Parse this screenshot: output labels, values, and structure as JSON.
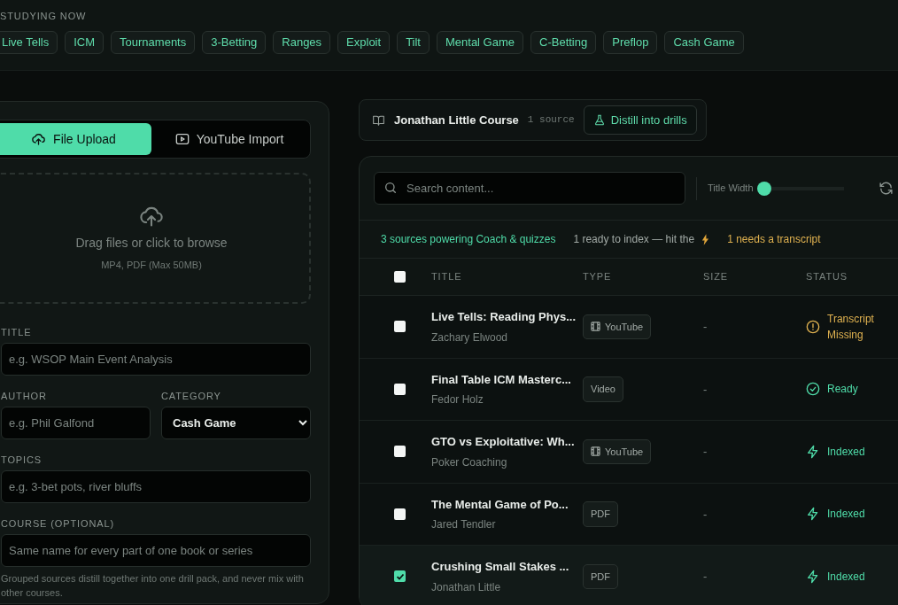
{
  "studying_now": {
    "label": "STUDYING NOW",
    "topics": [
      "Live Tells",
      "ICM",
      "Tournaments",
      "3-Betting",
      "Ranges",
      "Exploit",
      "Tilt",
      "Mental Game",
      "C-Betting",
      "Preflop",
      "Cash Game"
    ]
  },
  "upload": {
    "tabs": [
      {
        "label": "File Upload",
        "kind": "file",
        "selected": true
      },
      {
        "label": "YouTube Import",
        "kind": "youtube",
        "selected": false
      }
    ],
    "dropzone": {
      "title": "Drag files or click to browse",
      "hint": "MP4, PDF (Max 50MB)"
    },
    "fields": [
      {
        "label": "TITLE",
        "kind": "text",
        "placeholder": "e.g. WSOP Main Event Analysis"
      },
      {
        "label": "AUTHOR",
        "kind": "text",
        "placeholder": "e.g. Phil Galfond"
      },
      {
        "label": "CATEGORY",
        "kind": "select",
        "value": "Cash Game"
      },
      {
        "label": "TOPICS",
        "kind": "text",
        "placeholder": "e.g. 3-bet pots, river bluffs"
      },
      {
        "label": "COURSE (OPTIONAL)",
        "kind": "text",
        "placeholder": "Same name for every part of one book or series"
      }
    ],
    "help": "Grouped sources distill together into one drill pack, and never mix with other courses."
  },
  "course_bar": {
    "name": "Jonathan Little Course",
    "count": "1 source",
    "button": "Distill into drills"
  },
  "library": {
    "search": {
      "placeholder": "Search content..."
    },
    "title_width": {
      "label": "Title Width",
      "level": 0
    },
    "summary": {
      "sources": "3 sources powering Coach & quizzes",
      "ready": "1 ready to index — hit the",
      "transcript": "1 needs a transcript"
    },
    "columns": [
      "TITLE",
      "TYPE",
      "SIZE",
      "STATUS"
    ],
    "select_all": false,
    "rows": [
      {
        "title": "Live Tells: Reading Phys...",
        "author": "Zachary Elwood",
        "type": "YouTube",
        "type_icon": true,
        "size": "-",
        "status": "Transcript Missing",
        "kind": "missing",
        "selected": false
      },
      {
        "title": "Final Table ICM Masterc...",
        "author": "Fedor Holz",
        "type": "Video",
        "type_icon": false,
        "size": "-",
        "status": "Ready",
        "kind": "ready",
        "selected": false
      },
      {
        "title": "GTO vs Exploitative: Wh...",
        "author": "Poker Coaching",
        "type": "YouTube",
        "type_icon": true,
        "size": "-",
        "status": "Indexed",
        "kind": "indexed",
        "selected": false
      },
      {
        "title": "The Mental Game of Po...",
        "author": "Jared Tendler",
        "type": "PDF",
        "type_icon": false,
        "size": "-",
        "status": "Indexed",
        "kind": "indexed",
        "selected": false
      },
      {
        "title": "Crushing Small Stakes ...",
        "author": "Jonathan Little",
        "type": "PDF",
        "type_icon": false,
        "size": "-",
        "status": "Indexed",
        "kind": "indexed",
        "selected": true
      }
    ]
  }
}
